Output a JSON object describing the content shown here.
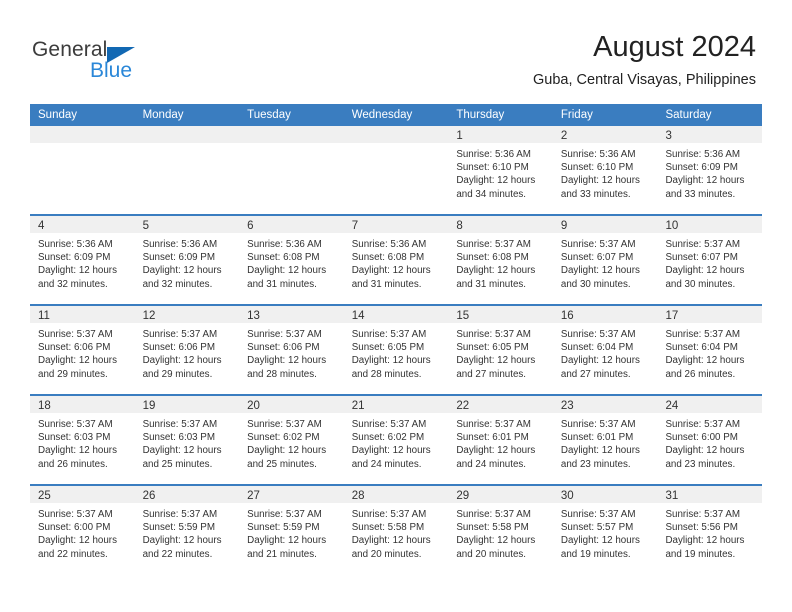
{
  "brand": {
    "name_part1": "General",
    "name_part2": "Blue",
    "accent_color": "#1268b3",
    "secondary_color": "#2a87d8"
  },
  "header": {
    "title": "August 2024",
    "subtitle": "Guba, Central Visayas, Philippines"
  },
  "calendar": {
    "header_color": "#3a7dc0",
    "day_band_color": "#f0f0f0",
    "weekdays": [
      "Sunday",
      "Monday",
      "Tuesday",
      "Wednesday",
      "Thursday",
      "Friday",
      "Saturday"
    ],
    "weeks": [
      [
        {
          "day": "",
          "lines": []
        },
        {
          "day": "",
          "lines": []
        },
        {
          "day": "",
          "lines": []
        },
        {
          "day": "",
          "lines": []
        },
        {
          "day": "1",
          "lines": [
            "Sunrise: 5:36 AM",
            "Sunset: 6:10 PM",
            "Daylight: 12 hours",
            "and 34 minutes."
          ]
        },
        {
          "day": "2",
          "lines": [
            "Sunrise: 5:36 AM",
            "Sunset: 6:10 PM",
            "Daylight: 12 hours",
            "and 33 minutes."
          ]
        },
        {
          "day": "3",
          "lines": [
            "Sunrise: 5:36 AM",
            "Sunset: 6:09 PM",
            "Daylight: 12 hours",
            "and 33 minutes."
          ]
        }
      ],
      [
        {
          "day": "4",
          "lines": [
            "Sunrise: 5:36 AM",
            "Sunset: 6:09 PM",
            "Daylight: 12 hours",
            "and 32 minutes."
          ]
        },
        {
          "day": "5",
          "lines": [
            "Sunrise: 5:36 AM",
            "Sunset: 6:09 PM",
            "Daylight: 12 hours",
            "and 32 minutes."
          ]
        },
        {
          "day": "6",
          "lines": [
            "Sunrise: 5:36 AM",
            "Sunset: 6:08 PM",
            "Daylight: 12 hours",
            "and 31 minutes."
          ]
        },
        {
          "day": "7",
          "lines": [
            "Sunrise: 5:36 AM",
            "Sunset: 6:08 PM",
            "Daylight: 12 hours",
            "and 31 minutes."
          ]
        },
        {
          "day": "8",
          "lines": [
            "Sunrise: 5:37 AM",
            "Sunset: 6:08 PM",
            "Daylight: 12 hours",
            "and 31 minutes."
          ]
        },
        {
          "day": "9",
          "lines": [
            "Sunrise: 5:37 AM",
            "Sunset: 6:07 PM",
            "Daylight: 12 hours",
            "and 30 minutes."
          ]
        },
        {
          "day": "10",
          "lines": [
            "Sunrise: 5:37 AM",
            "Sunset: 6:07 PM",
            "Daylight: 12 hours",
            "and 30 minutes."
          ]
        }
      ],
      [
        {
          "day": "11",
          "lines": [
            "Sunrise: 5:37 AM",
            "Sunset: 6:06 PM",
            "Daylight: 12 hours",
            "and 29 minutes."
          ]
        },
        {
          "day": "12",
          "lines": [
            "Sunrise: 5:37 AM",
            "Sunset: 6:06 PM",
            "Daylight: 12 hours",
            "and 29 minutes."
          ]
        },
        {
          "day": "13",
          "lines": [
            "Sunrise: 5:37 AM",
            "Sunset: 6:06 PM",
            "Daylight: 12 hours",
            "and 28 minutes."
          ]
        },
        {
          "day": "14",
          "lines": [
            "Sunrise: 5:37 AM",
            "Sunset: 6:05 PM",
            "Daylight: 12 hours",
            "and 28 minutes."
          ]
        },
        {
          "day": "15",
          "lines": [
            "Sunrise: 5:37 AM",
            "Sunset: 6:05 PM",
            "Daylight: 12 hours",
            "and 27 minutes."
          ]
        },
        {
          "day": "16",
          "lines": [
            "Sunrise: 5:37 AM",
            "Sunset: 6:04 PM",
            "Daylight: 12 hours",
            "and 27 minutes."
          ]
        },
        {
          "day": "17",
          "lines": [
            "Sunrise: 5:37 AM",
            "Sunset: 6:04 PM",
            "Daylight: 12 hours",
            "and 26 minutes."
          ]
        }
      ],
      [
        {
          "day": "18",
          "lines": [
            "Sunrise: 5:37 AM",
            "Sunset: 6:03 PM",
            "Daylight: 12 hours",
            "and 26 minutes."
          ]
        },
        {
          "day": "19",
          "lines": [
            "Sunrise: 5:37 AM",
            "Sunset: 6:03 PM",
            "Daylight: 12 hours",
            "and 25 minutes."
          ]
        },
        {
          "day": "20",
          "lines": [
            "Sunrise: 5:37 AM",
            "Sunset: 6:02 PM",
            "Daylight: 12 hours",
            "and 25 minutes."
          ]
        },
        {
          "day": "21",
          "lines": [
            "Sunrise: 5:37 AM",
            "Sunset: 6:02 PM",
            "Daylight: 12 hours",
            "and 24 minutes."
          ]
        },
        {
          "day": "22",
          "lines": [
            "Sunrise: 5:37 AM",
            "Sunset: 6:01 PM",
            "Daylight: 12 hours",
            "and 24 minutes."
          ]
        },
        {
          "day": "23",
          "lines": [
            "Sunrise: 5:37 AM",
            "Sunset: 6:01 PM",
            "Daylight: 12 hours",
            "and 23 minutes."
          ]
        },
        {
          "day": "24",
          "lines": [
            "Sunrise: 5:37 AM",
            "Sunset: 6:00 PM",
            "Daylight: 12 hours",
            "and 23 minutes."
          ]
        }
      ],
      [
        {
          "day": "25",
          "lines": [
            "Sunrise: 5:37 AM",
            "Sunset: 6:00 PM",
            "Daylight: 12 hours",
            "and 22 minutes."
          ]
        },
        {
          "day": "26",
          "lines": [
            "Sunrise: 5:37 AM",
            "Sunset: 5:59 PM",
            "Daylight: 12 hours",
            "and 22 minutes."
          ]
        },
        {
          "day": "27",
          "lines": [
            "Sunrise: 5:37 AM",
            "Sunset: 5:59 PM",
            "Daylight: 12 hours",
            "and 21 minutes."
          ]
        },
        {
          "day": "28",
          "lines": [
            "Sunrise: 5:37 AM",
            "Sunset: 5:58 PM",
            "Daylight: 12 hours",
            "and 20 minutes."
          ]
        },
        {
          "day": "29",
          "lines": [
            "Sunrise: 5:37 AM",
            "Sunset: 5:58 PM",
            "Daylight: 12 hours",
            "and 20 minutes."
          ]
        },
        {
          "day": "30",
          "lines": [
            "Sunrise: 5:37 AM",
            "Sunset: 5:57 PM",
            "Daylight: 12 hours",
            "and 19 minutes."
          ]
        },
        {
          "day": "31",
          "lines": [
            "Sunrise: 5:37 AM",
            "Sunset: 5:56 PM",
            "Daylight: 12 hours",
            "and 19 minutes."
          ]
        }
      ]
    ]
  }
}
